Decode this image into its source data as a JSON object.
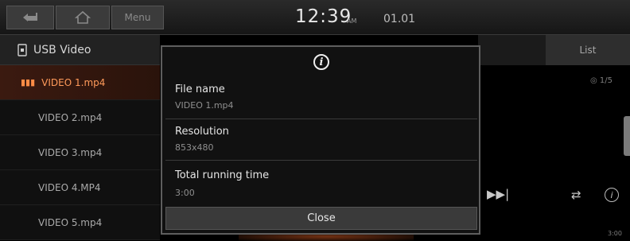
{
  "topbar": {
    "back_icon": "back-arrow-icon",
    "home_icon": "home-icon",
    "menu_label": "Menu",
    "time": "12:39",
    "ampm": "AM",
    "date": "01.01"
  },
  "source": {
    "icon": "usb-icon",
    "label": "USB Video"
  },
  "files": [
    {
      "name": "VIDEO 1.mp4",
      "active": true
    },
    {
      "name": "VIDEO 2.mp4",
      "active": false
    },
    {
      "name": "VIDEO 3.mp4",
      "active": false
    },
    {
      "name": "VIDEO 4.MP4",
      "active": false
    },
    {
      "name": "VIDEO 5.mp4",
      "active": false
    }
  ],
  "right": {
    "list_label": "List",
    "track_count": "1/5",
    "end_time": "3:00"
  },
  "dialog": {
    "info_icon": "info-icon",
    "file_name_label": "File name",
    "file_name_value": "VIDEO 1.mp4",
    "resolution_label": "Resolution",
    "resolution_value": "853x480",
    "running_time_label": "Total running time",
    "running_time_value": "3:00",
    "close_label": "Close"
  },
  "colors": {
    "accent": "#ff8c46",
    "background": "#000000"
  }
}
